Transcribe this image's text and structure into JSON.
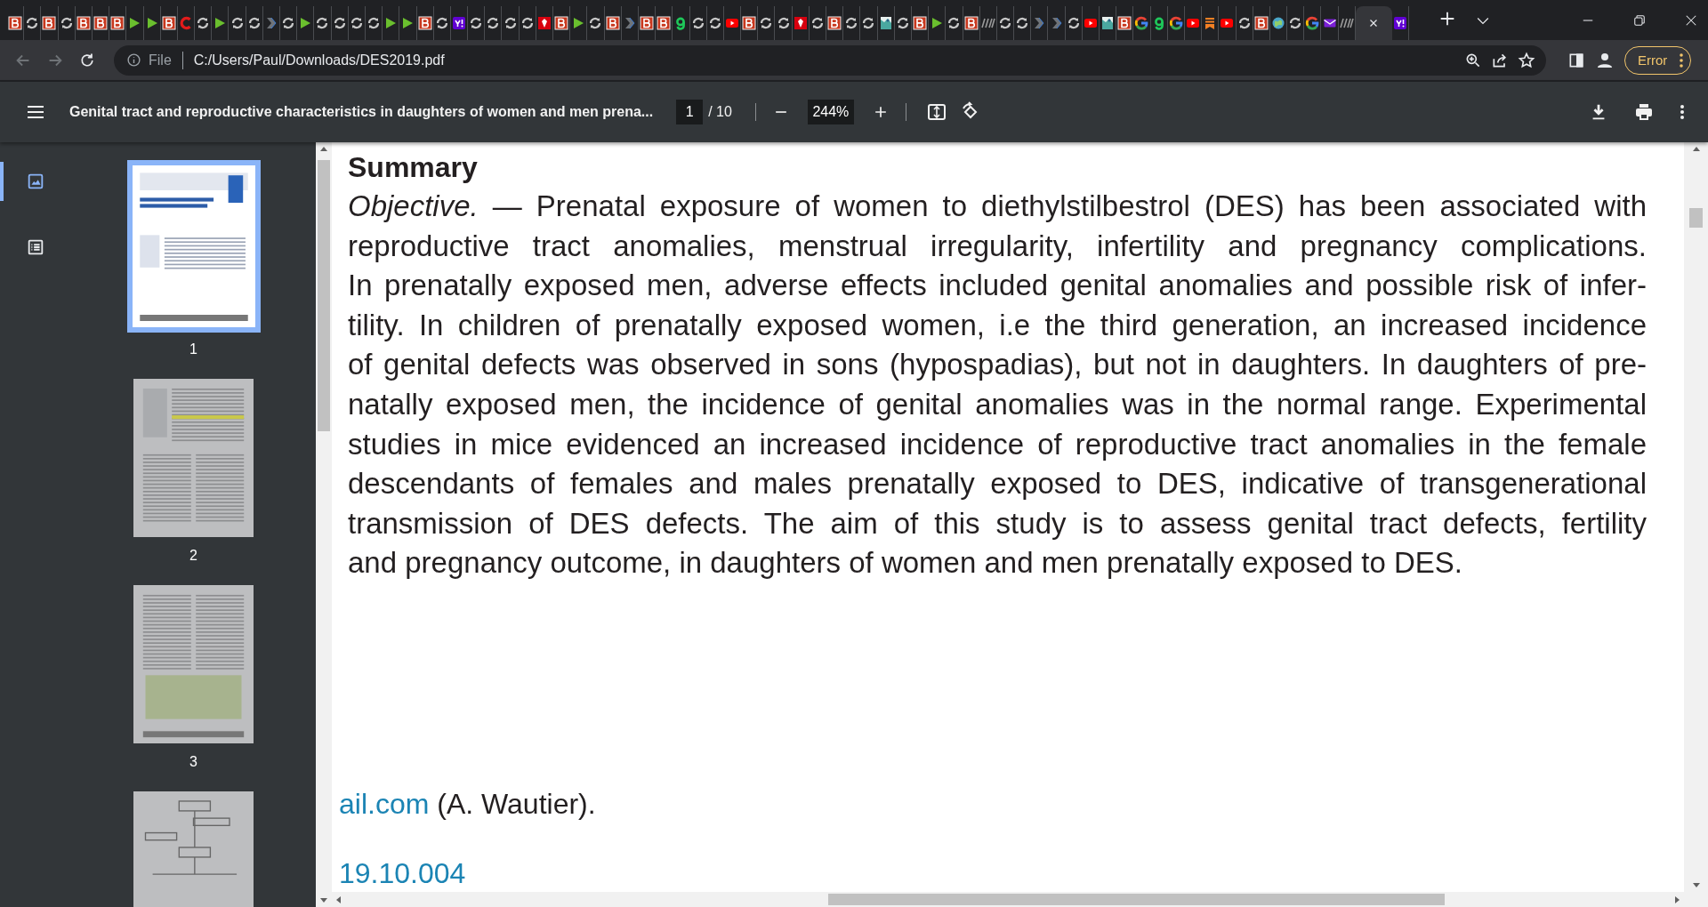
{
  "tabs": [
    {
      "kind": "b",
      "selected": false
    },
    {
      "kind": "sync",
      "selected": false
    },
    {
      "kind": "b",
      "selected": false
    },
    {
      "kind": "sync",
      "selected": false
    },
    {
      "kind": "b",
      "selected": false
    },
    {
      "kind": "b",
      "selected": false
    },
    {
      "kind": "b",
      "selected": false
    },
    {
      "kind": "play",
      "selected": false
    },
    {
      "kind": "play",
      "selected": false
    },
    {
      "kind": "b",
      "selected": false
    },
    {
      "kind": "c",
      "selected": false
    },
    {
      "kind": "sync",
      "selected": false
    },
    {
      "kind": "play",
      "selected": false
    },
    {
      "kind": "sync",
      "selected": false
    },
    {
      "kind": "sync",
      "selected": false
    },
    {
      "kind": "arrow",
      "selected": false
    },
    {
      "kind": "sync",
      "selected": false
    },
    {
      "kind": "play",
      "selected": false
    },
    {
      "kind": "sync",
      "selected": false
    },
    {
      "kind": "sync",
      "selected": false
    },
    {
      "kind": "sync",
      "selected": false
    },
    {
      "kind": "sync",
      "selected": false
    },
    {
      "kind": "play",
      "selected": false
    },
    {
      "kind": "play",
      "selected": false
    },
    {
      "kind": "b",
      "selected": false
    },
    {
      "kind": "sync",
      "selected": false
    },
    {
      "kind": "yahoo",
      "selected": false
    },
    {
      "kind": "sync",
      "selected": false
    },
    {
      "kind": "sync",
      "selected": false
    },
    {
      "kind": "sync",
      "selected": false
    },
    {
      "kind": "sync",
      "selected": false
    },
    {
      "kind": "ruby",
      "selected": false
    },
    {
      "kind": "b",
      "selected": false
    },
    {
      "kind": "play",
      "selected": false
    },
    {
      "kind": "sync",
      "selected": false
    },
    {
      "kind": "b",
      "selected": false
    },
    {
      "kind": "arrow",
      "selected": false
    },
    {
      "kind": "b",
      "selected": false
    },
    {
      "kind": "b",
      "selected": false
    },
    {
      "kind": "g",
      "selected": false
    },
    {
      "kind": "sync",
      "selected": false
    },
    {
      "kind": "sync",
      "selected": false
    },
    {
      "kind": "youtube",
      "selected": false
    },
    {
      "kind": "b",
      "selected": false
    },
    {
      "kind": "sync",
      "selected": false
    },
    {
      "kind": "sync",
      "selected": false
    },
    {
      "kind": "ruby",
      "selected": false
    },
    {
      "kind": "sync",
      "selected": false
    },
    {
      "kind": "b",
      "selected": false
    },
    {
      "kind": "sync",
      "selected": false
    },
    {
      "kind": "sync",
      "selected": false
    },
    {
      "kind": "image",
      "selected": false
    },
    {
      "kind": "sync",
      "selected": false
    },
    {
      "kind": "b",
      "selected": false
    },
    {
      "kind": "play",
      "selected": false
    },
    {
      "kind": "sync",
      "selected": false
    },
    {
      "kind": "b",
      "selected": false
    },
    {
      "kind": "stripes",
      "selected": false
    },
    {
      "kind": "sync",
      "selected": false
    },
    {
      "kind": "sync",
      "selected": false
    },
    {
      "kind": "arrow",
      "selected": false
    },
    {
      "kind": "arrow",
      "selected": false
    },
    {
      "kind": "sync",
      "selected": false
    },
    {
      "kind": "youtube",
      "selected": false
    },
    {
      "kind": "image",
      "selected": false
    },
    {
      "kind": "b",
      "selected": false
    },
    {
      "kind": "google",
      "selected": false
    },
    {
      "kind": "g",
      "selected": false
    },
    {
      "kind": "google",
      "selected": false
    },
    {
      "kind": "youtube",
      "selected": false
    },
    {
      "kind": "bookmark",
      "selected": false
    },
    {
      "kind": "youtube",
      "selected": false
    },
    {
      "kind": "sync",
      "selected": false
    },
    {
      "kind": "b",
      "selected": false
    },
    {
      "kind": "globe",
      "selected": false
    },
    {
      "kind": "sync",
      "selected": false
    },
    {
      "kind": "google",
      "selected": false
    },
    {
      "kind": "mail",
      "selected": false
    },
    {
      "kind": "stripes",
      "selected": false
    },
    {
      "kind": "blank",
      "selected": true
    },
    {
      "kind": "yahoo",
      "selected": false
    }
  ],
  "address_bar": {
    "scheme": "File",
    "url": "C:/Users/Paul/Downloads/DES2019.pdf"
  },
  "profile_button": {
    "label": "Error"
  },
  "pdf_toolbar": {
    "title": "Genital tract and reproductive characteristics in daughters of women and men prena...",
    "page": "1",
    "page_total": "/ 10",
    "zoom": "244%"
  },
  "sidebar": {
    "views": [
      {
        "kind": "thumbnails",
        "selected": true
      },
      {
        "kind": "outline",
        "selected": false
      }
    ],
    "thumbnails": [
      {
        "label": "1",
        "selected": true
      },
      {
        "label": "2",
        "selected": false
      },
      {
        "label": "3",
        "selected": false
      },
      {
        "selected": false
      }
    ]
  },
  "document": {
    "heading": "Summary",
    "lines": [
      "*Objective.* — Prenatal exposure of women to diethylstilbestrol (DES) has been associated with",
      "reproductive tract anomalies, menstrual irregularity, infertility and pregnancy complications.",
      "In prenatally exposed men, adverse effects included genital anomalies and possible risk of infer-",
      "tility. In children of prenatally exposed women, i.e the third generation, an increased incidence",
      "of genital defects was observed in sons (hypospadias), but not in daughters. In daughters of pre-",
      "natally exposed men, the incidence of genital anomalies was in the normal range. Experimental",
      "studies in mice evidenced an increased incidence of reproductive tract anomalies in the female",
      "descendants of females and males prenatally exposed to DES, indicative of transgenerational",
      "transmission of DES defects. The aim of this study is to assess genital tract defects, fertility",
      "and pregnancy outcome, in daughters of women and men prenatally exposed to DES."
    ],
    "email_link": "ail.com",
    "email_owner": "(A. Wautier).",
    "doi_link": "19.10.004"
  }
}
